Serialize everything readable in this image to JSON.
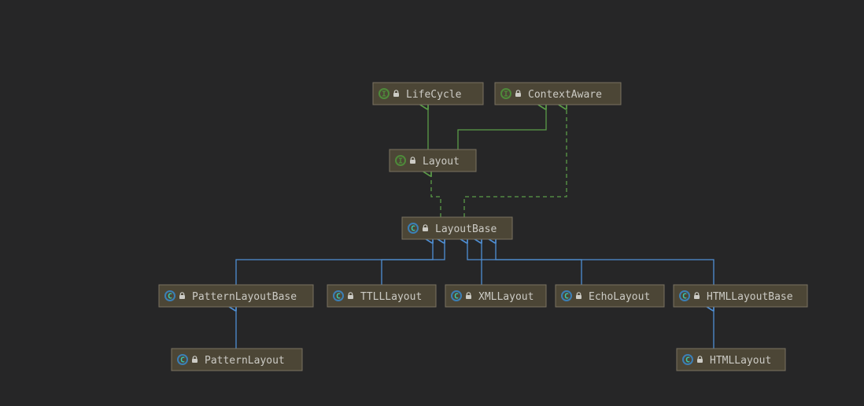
{
  "diagram": {
    "lifecycle": {
      "name": "LifeCycle",
      "kind": "interface"
    },
    "contextaware": {
      "name": "ContextAware",
      "kind": "interface"
    },
    "layout": {
      "name": "Layout",
      "kind": "interface"
    },
    "layoutbase": {
      "name": "LayoutBase",
      "kind": "class"
    },
    "patternlayoutbase": {
      "name": "PatternLayoutBase",
      "kind": "class"
    },
    "ttlllayout": {
      "name": "TTLLLayout",
      "kind": "class"
    },
    "xmllayout": {
      "name": "XMLLayout",
      "kind": "class"
    },
    "echolayout": {
      "name": "EchoLayout",
      "kind": "class"
    },
    "htmllayoutbase": {
      "name": "HTMLLayoutBase",
      "kind": "class"
    },
    "patternlayout": {
      "name": "PatternLayout",
      "kind": "class"
    },
    "htmllayout": {
      "name": "HTMLLayout",
      "kind": "class"
    }
  },
  "chart_data": {
    "type": "uml_class_hierarchy",
    "nodes": [
      {
        "id": "LifeCycle",
        "kind": "interface"
      },
      {
        "id": "ContextAware",
        "kind": "interface"
      },
      {
        "id": "Layout",
        "kind": "interface"
      },
      {
        "id": "LayoutBase",
        "kind": "abstract_class"
      },
      {
        "id": "PatternLayoutBase",
        "kind": "abstract_class"
      },
      {
        "id": "TTLLLayout",
        "kind": "class"
      },
      {
        "id": "XMLLayout",
        "kind": "class"
      },
      {
        "id": "EchoLayout",
        "kind": "class"
      },
      {
        "id": "HTMLLayoutBase",
        "kind": "abstract_class"
      },
      {
        "id": "PatternLayout",
        "kind": "class"
      },
      {
        "id": "HTMLLayout",
        "kind": "class"
      }
    ],
    "edges": [
      {
        "from": "Layout",
        "to": "LifeCycle",
        "relation": "extends_interface"
      },
      {
        "from": "Layout",
        "to": "ContextAware",
        "relation": "extends_interface"
      },
      {
        "from": "LayoutBase",
        "to": "Layout",
        "relation": "implements"
      },
      {
        "from": "LayoutBase",
        "to": "ContextAware",
        "relation": "implements"
      },
      {
        "from": "PatternLayoutBase",
        "to": "LayoutBase",
        "relation": "extends"
      },
      {
        "from": "TTLLLayout",
        "to": "LayoutBase",
        "relation": "extends"
      },
      {
        "from": "XMLLayout",
        "to": "LayoutBase",
        "relation": "extends"
      },
      {
        "from": "EchoLayout",
        "to": "LayoutBase",
        "relation": "extends"
      },
      {
        "from": "HTMLLayoutBase",
        "to": "LayoutBase",
        "relation": "extends"
      },
      {
        "from": "PatternLayout",
        "to": "PatternLayoutBase",
        "relation": "extends"
      },
      {
        "from": "HTMLLayout",
        "to": "HTMLLayoutBase",
        "relation": "extends"
      }
    ]
  }
}
